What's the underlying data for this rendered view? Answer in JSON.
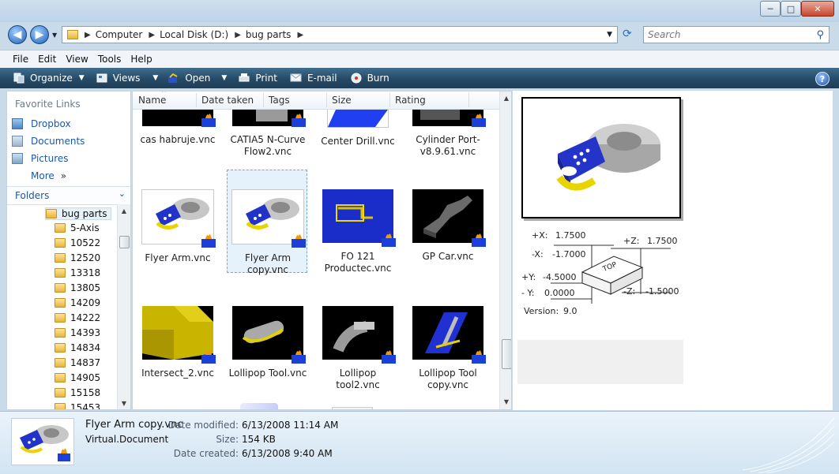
{
  "window": {
    "min": "─",
    "max": "□",
    "close": "✕"
  },
  "address": {
    "crumbs": [
      "Computer",
      "Local Disk (D:)",
      "bug parts"
    ]
  },
  "search": {
    "placeholder": "Search"
  },
  "menu": {
    "items": [
      "File",
      "Edit",
      "View",
      "Tools",
      "Help"
    ]
  },
  "toolbar": {
    "organize": "Organize",
    "views": "Views",
    "open": "Open",
    "print": "Print",
    "email": "E-mail",
    "burn": "Burn",
    "help": "?"
  },
  "sidebar": {
    "favorites_heading": "Favorite Links",
    "links": [
      "Dropbox",
      "Documents",
      "Pictures",
      "More"
    ],
    "more_arrow": "»",
    "folders_heading": "Folders",
    "tree": [
      "bug parts",
      "5-Axis",
      "10522",
      "12520",
      "13318",
      "13805",
      "14209",
      "14222",
      "14393",
      "14834",
      "14837",
      "14905",
      "15158",
      "15453"
    ]
  },
  "columns": [
    "Name",
    "Date taken",
    "Tags",
    "Size",
    "Rating"
  ],
  "files": [
    {
      "name": "cas habruje.vnc",
      "kind": "dark-top"
    },
    {
      "name": "CATIA5 N-Curve Flow2.vnc",
      "kind": "dark-top"
    },
    {
      "name": "Center Drill.vnc",
      "kind": "blue-top"
    },
    {
      "name": "Cylinder Port-v8.9.61.vnc",
      "kind": "dark-top"
    },
    {
      "name": "Flyer Arm.vnc",
      "kind": "flyer"
    },
    {
      "name": "Flyer Arm copy.vnc",
      "kind": "flyer"
    },
    {
      "name": "FO 121 Productec.vnc",
      "kind": "fo121"
    },
    {
      "name": "GP Car.vnc",
      "kind": "gpcar"
    },
    {
      "name": "Intersect_2.vnc",
      "kind": "intersect"
    },
    {
      "name": "Lollipop Tool.vnc",
      "kind": "lollipop"
    },
    {
      "name": "Lollipop tool2.vnc",
      "kind": "lollipop2"
    },
    {
      "name": "Lollipop Tool copy.vnc",
      "kind": "lollipop3"
    }
  ],
  "selected_file": "Flyer Arm copy.vnc",
  "preview": {
    "rows": [
      {
        "label": "+X:",
        "value": "1.7500"
      },
      {
        "label": "-X:",
        "value": "-1.7000"
      },
      {
        "label": "+Y:",
        "value": "-4.5000"
      },
      {
        "label": "- Y:",
        "value": "0.0000"
      }
    ],
    "zrows": [
      {
        "label": "+Z:",
        "value": "1.7500"
      },
      {
        "label": "-Z:",
        "value": "-1.5000"
      }
    ],
    "box_label": "TOP",
    "version_label": "Version:",
    "version_value": "9.0"
  },
  "details": {
    "name": "Flyer Arm copy.vnc",
    "type": "Virtual.Document",
    "modified_label": "Date modified:",
    "modified": "6/13/2008 11:14 AM",
    "size_label": "Size:",
    "size": "154 KB",
    "created_label": "Date created:",
    "created": "6/13/2008 9:40 AM"
  },
  "colors": {
    "toolbar": "#264a66",
    "selection": "#e5f2fb",
    "link": "#1a57a6"
  }
}
